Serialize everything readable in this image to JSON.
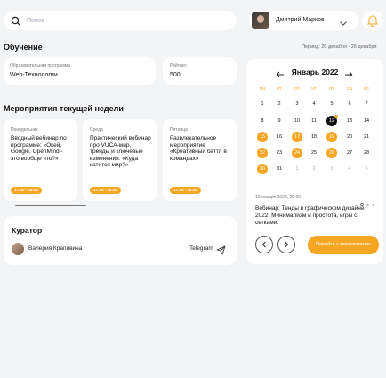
{
  "search": {
    "placeholder": "Поиск"
  },
  "user": {
    "name": "Дмитрий Марков"
  },
  "education": {
    "title": "Обучение",
    "period": "Период: 20 декабря - 26 декабря",
    "program_label": "Образовательная программа",
    "program_value": "Web-Технологии",
    "rating_label": "Рейтинг:",
    "rating_value": "500"
  },
  "events": {
    "title": "Мероприятия текущей недели",
    "cards": [
      {
        "day": "Понедельник",
        "title": "Вводный вебинар по программе: «Окей, Google, OpenMind - это вообще что?»",
        "time": "17:00 - 18:00"
      },
      {
        "day": "Среда",
        "title": "Практический вебинар про VUCA-мир, тренды и ключевые изменения: «Куда катится мир?»",
        "time": "17:00 - 18:00"
      },
      {
        "day": "Пятница",
        "title": "Развлекательное мероприятие «Креативный баттл в командах»",
        "time": "17:00 - 18:00"
      }
    ]
  },
  "curator": {
    "title": "Куратор",
    "name": "Валерия  Крапивина",
    "telegram_label": "Telegram"
  },
  "calendar": {
    "month_label": "Январь 2022",
    "weekdays": [
      "ПН",
      "ВТ",
      "СР",
      "ЧТ",
      "ПТ",
      "СБ",
      "ВС"
    ],
    "weeks": [
      [
        {
          "d": "1"
        },
        {
          "d": "2"
        },
        {
          "d": "3"
        },
        {
          "d": "4"
        },
        {
          "d": "5"
        },
        {
          "d": "6"
        },
        {
          "d": "7"
        }
      ],
      [
        {
          "d": "8"
        },
        {
          "d": "9"
        },
        {
          "d": "10"
        },
        {
          "d": "11"
        },
        {
          "d": "12",
          "today": true
        },
        {
          "d": "13"
        },
        {
          "d": "14"
        }
      ],
      [
        {
          "d": "15",
          "ev": true
        },
        {
          "d": "16"
        },
        {
          "d": "17",
          "ev": true
        },
        {
          "d": "18"
        },
        {
          "d": "19",
          "ev": true
        },
        {
          "d": "20"
        },
        {
          "d": "21"
        }
      ],
      [
        {
          "d": "22",
          "ev": true
        },
        {
          "d": "23"
        },
        {
          "d": "24",
          "ev": true
        },
        {
          "d": "25"
        },
        {
          "d": "26",
          "ev": true
        },
        {
          "d": "27"
        },
        {
          "d": "28"
        }
      ],
      [
        {
          "d": "30",
          "ev": true
        },
        {
          "d": "31"
        },
        {
          "d": "1",
          "muted": true
        },
        {
          "d": "2",
          "muted": true
        },
        {
          "d": "3",
          "muted": true
        },
        {
          "d": "4",
          "muted": true
        },
        {
          "d": "5",
          "muted": true
        }
      ]
    ],
    "selected_datetime": "12 января 2022, 20:00",
    "event_text": "Вебинар: Тенды в графическом дизайне 2022. Минимализм и простота, игры с сетками.",
    "go_button": "Перейти к мероприятию"
  },
  "colors": {
    "accent": "#f5a623",
    "background": "#f3f4f6"
  }
}
